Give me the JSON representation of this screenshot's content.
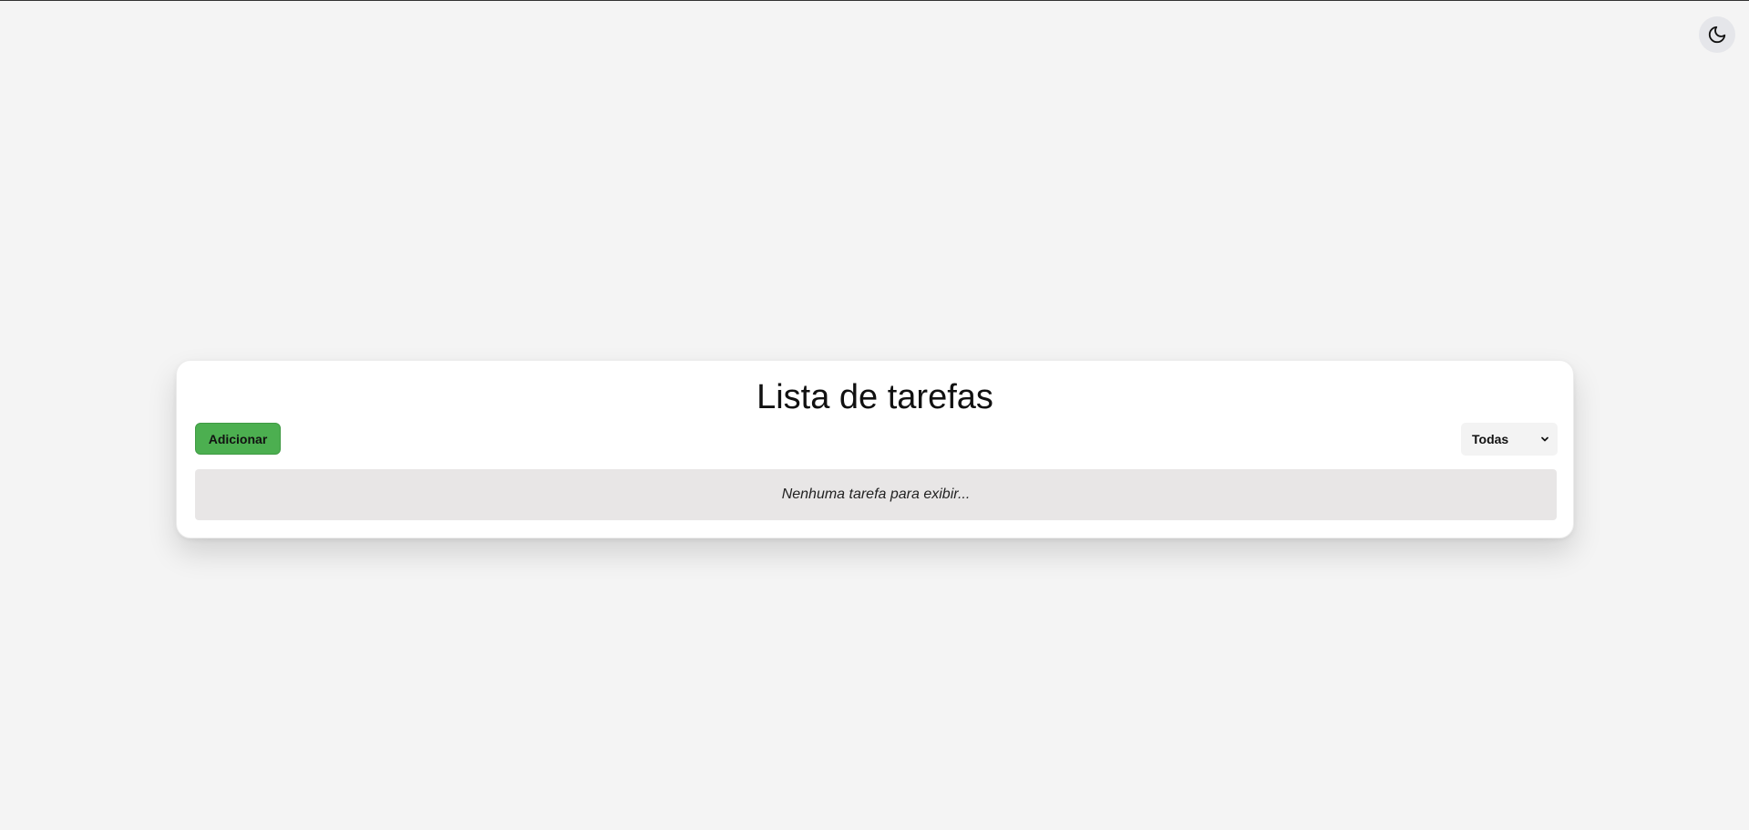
{
  "header": {
    "theme_toggle_icon": "moon-icon"
  },
  "card": {
    "title": "Lista de tarefas",
    "add_label": "Adicionar",
    "filter": {
      "selected": "Todas",
      "icon": "chevron-down-icon"
    },
    "empty_message": "Nenhuma tarefa para exibir..."
  },
  "colors": {
    "background": "#f4f4f4",
    "card": "#ffffff",
    "add_button": "#4caf50",
    "empty_state": "#e8e6e6",
    "toggle_bg": "#e5e6ea"
  }
}
